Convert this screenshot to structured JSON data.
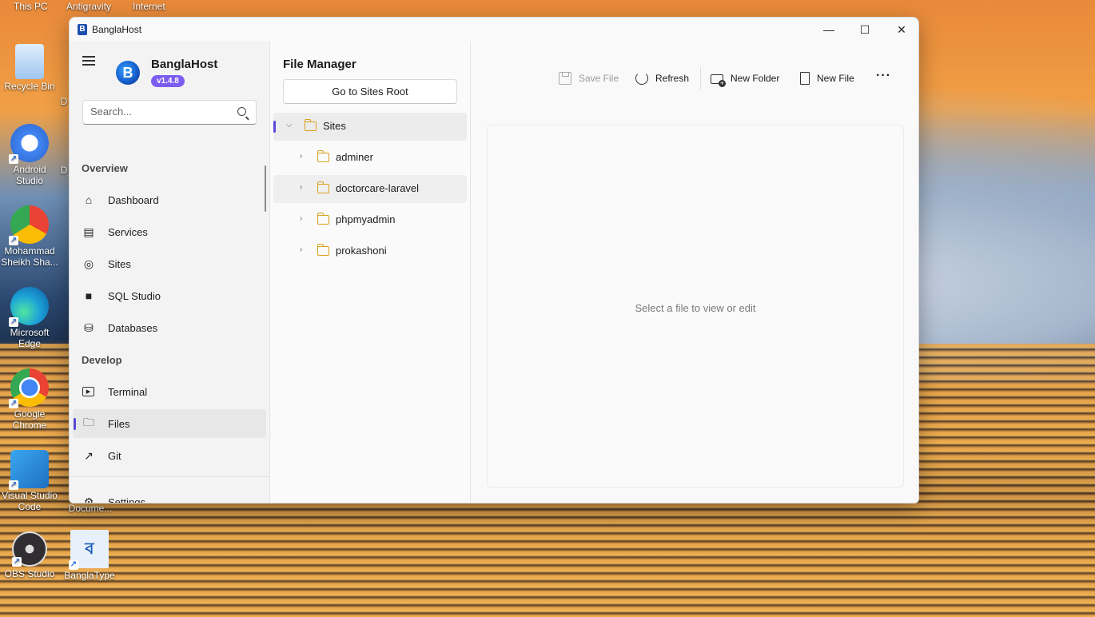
{
  "desktop": {
    "top_labels": [
      "This PC",
      "Antigravity",
      "Internet"
    ],
    "icons": [
      {
        "label": "Recycle Bin",
        "icon": "recycle-bin-icon",
        "color": "#9fc6ef"
      },
      {
        "label": "Android Studio",
        "icon": "android-studio-icon",
        "color": "#4285f4"
      },
      {
        "label": "Mohammad Sheikh Sha...",
        "icon": "chrome-profile-icon",
        "color": "#e94235"
      },
      {
        "label": "Microsoft Edge",
        "icon": "edge-icon",
        "color": "#1da3d8"
      },
      {
        "label": "Google Chrome",
        "icon": "chrome-icon",
        "color": "#34a853"
      },
      {
        "label": "Visual Studio Code",
        "icon": "vscode-icon",
        "color": "#1f8ad2"
      },
      {
        "label": "OBS Studio",
        "icon": "obs-icon",
        "color": "#302e31"
      },
      {
        "label": "BanglaType",
        "icon": "banglatype-icon",
        "color": "#e8f1fb"
      }
    ],
    "partial_labels": [
      "D",
      "D",
      "Docume..."
    ]
  },
  "window": {
    "title": "BanglaHost",
    "controls": {
      "minimize": "—",
      "maximize": "☐",
      "close": "✕"
    }
  },
  "sidebar": {
    "brand": "BanglaHost",
    "version": "v1.4.8",
    "search_placeholder": "Search...",
    "sections": {
      "overview": "Overview",
      "develop": "Develop"
    },
    "items": [
      {
        "label": "Dashboard",
        "icon": "home-icon"
      },
      {
        "label": "Services",
        "icon": "services-icon"
      },
      {
        "label": "Sites",
        "icon": "globe-icon"
      },
      {
        "label": "SQL Studio",
        "icon": "folder-filled-icon"
      },
      {
        "label": "Databases",
        "icon": "database-icon"
      },
      {
        "label": "Terminal",
        "icon": "terminal-icon"
      },
      {
        "label": "Files",
        "icon": "folder-icon",
        "active": true
      },
      {
        "label": "Git",
        "icon": "arrow-up-right-icon"
      }
    ],
    "settings": "Settings"
  },
  "file_manager": {
    "title": "File Manager",
    "go_root": "Go to Sites Root",
    "tree": [
      {
        "label": "Sites",
        "expanded": true,
        "level": 0
      },
      {
        "label": "adminer",
        "level": 1
      },
      {
        "label": "doctorcare-laravel",
        "level": 1
      },
      {
        "label": "phpmyadmin",
        "level": 1
      },
      {
        "label": "prokashoni",
        "level": 1
      }
    ]
  },
  "toolbar": {
    "save": "Save File",
    "refresh": "Refresh",
    "new_folder": "New Folder",
    "new_file": "New File",
    "more": "···"
  },
  "viewer": {
    "empty_text": "Select a file to view or edit"
  },
  "colors": {
    "accent": "#5b4bdb",
    "version_badge": "#7d5cf0",
    "folder": "#d9a21b"
  }
}
